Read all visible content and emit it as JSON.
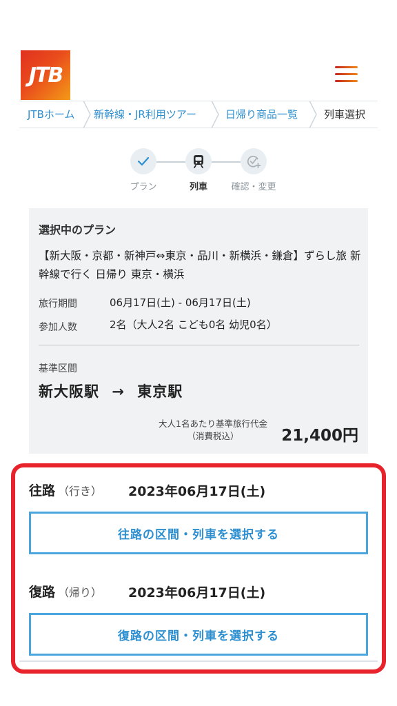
{
  "header": {
    "logo_text": "JTB",
    "menu_icon": "hamburger-menu-icon"
  },
  "breadcrumb": [
    {
      "label": "JTBホーム"
    },
    {
      "label": "新幹線・JR利用ツアー"
    },
    {
      "label": "日帰り商品一覧"
    },
    {
      "label": "列車選択"
    }
  ],
  "steps": [
    {
      "label": "プラン",
      "icon": "check-icon",
      "state": "done"
    },
    {
      "label": "列車",
      "icon": "train-icon",
      "state": "active"
    },
    {
      "label": "確認・変更",
      "icon": "check-plus-icon",
      "state": "pending"
    }
  ],
  "plan": {
    "heading": "選択中のプラン",
    "title": "【新大阪・京都・新神戸⇔東京・品川・新横浜・鎌倉】ずらし旅 新幹線で行く 日帰り 東京・横浜",
    "period_label": "旅行期間",
    "period_value": "06月17日(土) - 06月17日(土)",
    "people_label": "参加人数",
    "people_value": "2名（大人2名 こども0名 幼児0名）",
    "section_label": "基準区間",
    "from": "新大阪駅",
    "arrow": "→",
    "to": "東京駅",
    "price_note_1": "大人1名あたり基準旅行代金",
    "price_note_2": "（消費税込）",
    "price": "21,400円"
  },
  "outbound": {
    "title": "往路",
    "sub": "（行き）",
    "date": "2023年06月17日(土)",
    "button": "往路の区間・列車を選択する"
  },
  "return": {
    "title": "復路",
    "sub": "（帰り）",
    "date": "2023年06月17日(土)",
    "button": "復路の区間・列車を選択する"
  },
  "colors": {
    "link": "#2d8fcf",
    "highlight_border": "#e8232b",
    "button_border": "#4aa6dc",
    "panel_bg": "#f0f2f3"
  }
}
